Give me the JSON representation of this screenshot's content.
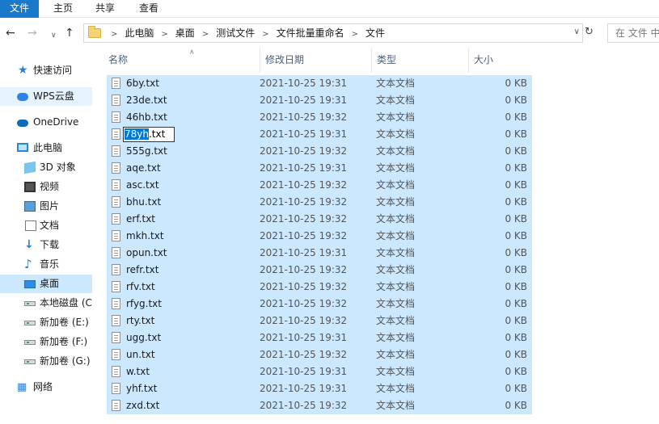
{
  "ribbon": {
    "tabs": [
      "文件",
      "主页",
      "共享",
      "查看"
    ]
  },
  "address": {
    "crumbs": [
      "此电脑",
      "桌面",
      "测试文件",
      "文件批量重命名",
      "文件"
    ],
    "search_placeholder": "在 文件 中"
  },
  "sidebar": {
    "items": [
      {
        "label": "快速访问",
        "icon": "star-icon"
      },
      {
        "label": "WPS云盘",
        "icon": "cloud-icon"
      },
      {
        "label": "OneDrive",
        "icon": "onedrive-icon"
      },
      {
        "label": "此电脑",
        "icon": "computer-icon"
      },
      {
        "label": "3D 对象",
        "icon": "cube-icon"
      },
      {
        "label": "视频",
        "icon": "video-icon"
      },
      {
        "label": "图片",
        "icon": "picture-icon"
      },
      {
        "label": "文档",
        "icon": "document-icon"
      },
      {
        "label": "下载",
        "icon": "download-icon"
      },
      {
        "label": "音乐",
        "icon": "music-icon"
      },
      {
        "label": "桌面",
        "icon": "desktop-icon"
      },
      {
        "label": "本地磁盘 (C",
        "icon": "drive-icon"
      },
      {
        "label": "新加卷 (E:)",
        "icon": "drive-icon"
      },
      {
        "label": "新加卷 (F:)",
        "icon": "drive-icon"
      },
      {
        "label": "新加卷 (G:)",
        "icon": "drive-icon"
      },
      {
        "label": "网络",
        "icon": "network-icon"
      }
    ]
  },
  "columns": {
    "name": "名称",
    "date": "修改日期",
    "type": "类型",
    "size": "大小"
  },
  "rename": {
    "selected": "78yh",
    "rest": ".txt"
  },
  "files": [
    {
      "name": "6by.txt",
      "date": "2021-10-25 19:31",
      "type": "文本文档",
      "size": "0 KB"
    },
    {
      "name": "23de.txt",
      "date": "2021-10-25 19:31",
      "type": "文本文档",
      "size": "0 KB"
    },
    {
      "name": "46hb.txt",
      "date": "2021-10-25 19:32",
      "type": "文本文档",
      "size": "0 KB"
    },
    {
      "name": "78yh.txt",
      "date": "2021-10-25 19:31",
      "type": "文本文档",
      "size": "0 KB"
    },
    {
      "name": "555g.txt",
      "date": "2021-10-25 19:32",
      "type": "文本文档",
      "size": "0 KB"
    },
    {
      "name": "aqe.txt",
      "date": "2021-10-25 19:31",
      "type": "文本文档",
      "size": "0 KB"
    },
    {
      "name": "asc.txt",
      "date": "2021-10-25 19:32",
      "type": "文本文档",
      "size": "0 KB"
    },
    {
      "name": "bhu.txt",
      "date": "2021-10-25 19:32",
      "type": "文本文档",
      "size": "0 KB"
    },
    {
      "name": "erf.txt",
      "date": "2021-10-25 19:32",
      "type": "文本文档",
      "size": "0 KB"
    },
    {
      "name": "mkh.txt",
      "date": "2021-10-25 19:32",
      "type": "文本文档",
      "size": "0 KB"
    },
    {
      "name": "opun.txt",
      "date": "2021-10-25 19:31",
      "type": "文本文档",
      "size": "0 KB"
    },
    {
      "name": "refr.txt",
      "date": "2021-10-25 19:32",
      "type": "文本文档",
      "size": "0 KB"
    },
    {
      "name": "rfv.txt",
      "date": "2021-10-25 19:32",
      "type": "文本文档",
      "size": "0 KB"
    },
    {
      "name": "rfyg.txt",
      "date": "2021-10-25 19:32",
      "type": "文本文档",
      "size": "0 KB"
    },
    {
      "name": "rty.txt",
      "date": "2021-10-25 19:32",
      "type": "文本文档",
      "size": "0 KB"
    },
    {
      "name": "ugg.txt",
      "date": "2021-10-25 19:31",
      "type": "文本文档",
      "size": "0 KB"
    },
    {
      "name": "un.txt",
      "date": "2021-10-25 19:32",
      "type": "文本文档",
      "size": "0 KB"
    },
    {
      "name": "w.txt",
      "date": "2021-10-25 19:31",
      "type": "文本文档",
      "size": "0 KB"
    },
    {
      "name": "yhf.txt",
      "date": "2021-10-25 19:31",
      "type": "文本文档",
      "size": "0 KB"
    },
    {
      "name": "zxd.txt",
      "date": "2021-10-25 19:32",
      "type": "文本文档",
      "size": "0 KB"
    }
  ]
}
